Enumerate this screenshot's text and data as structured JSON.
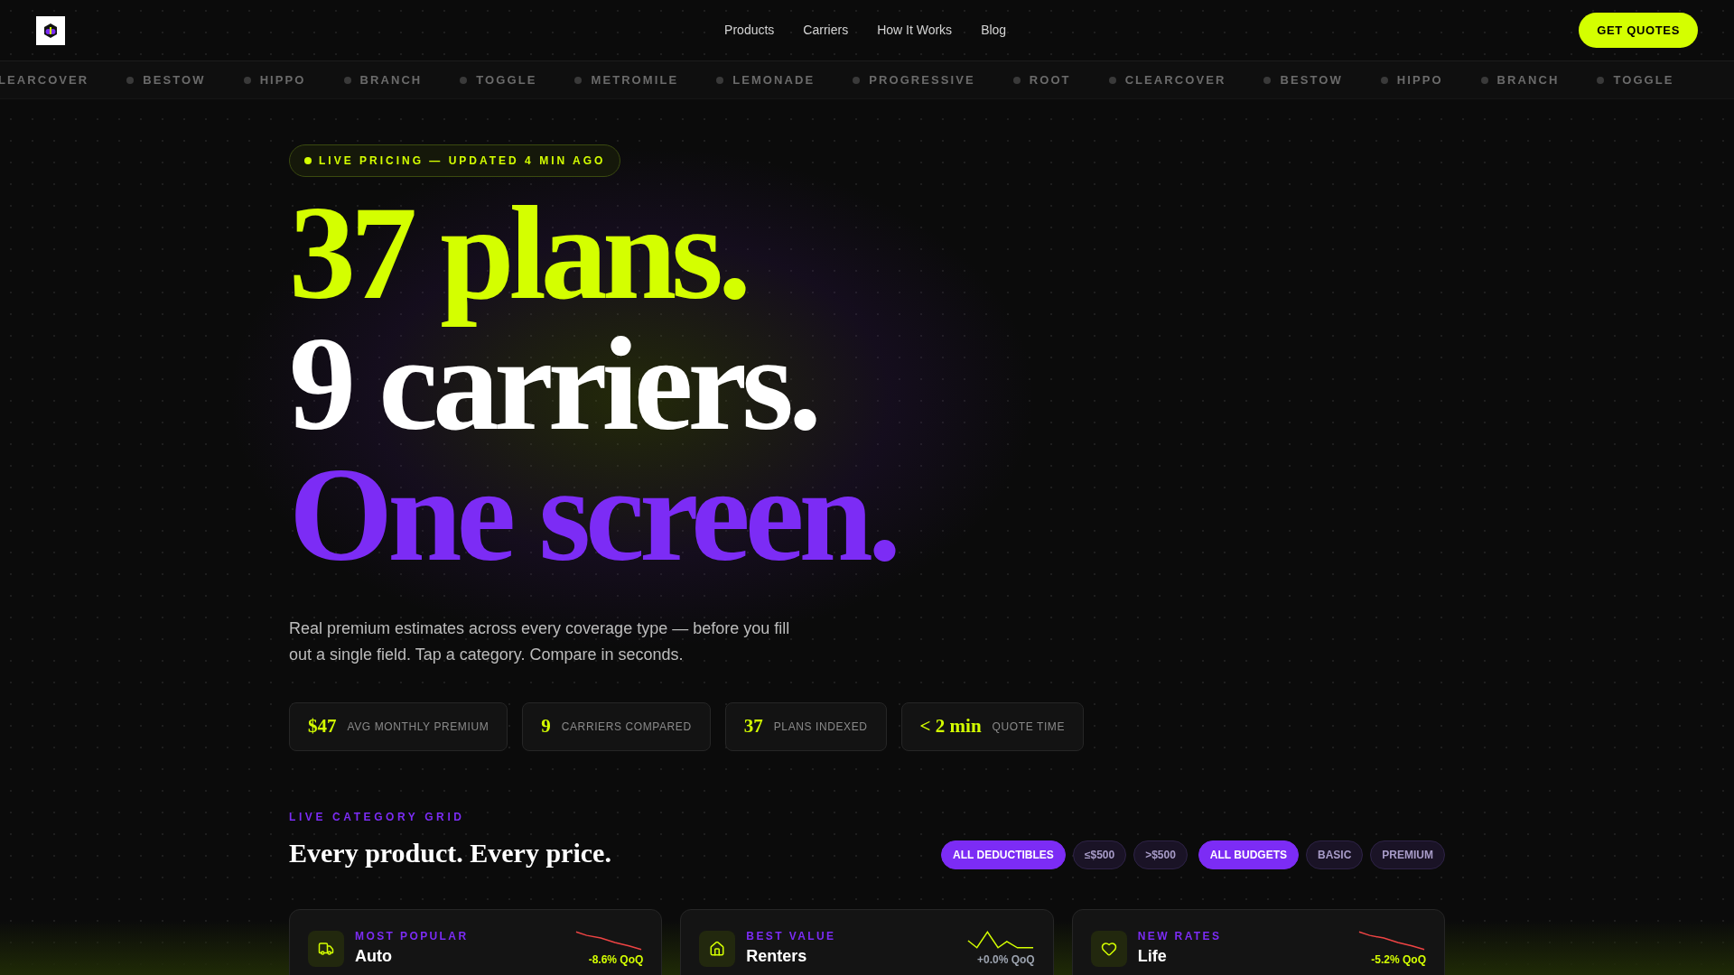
{
  "nav": {
    "links": [
      "Products",
      "Carriers",
      "How It Works",
      "Blog"
    ],
    "cta": "GET QUOTES"
  },
  "ticker": [
    {
      "name": "LEARCOVER",
      "cut": true
    },
    {
      "name": "BESTOW",
      "cut": false
    },
    {
      "name": "HIPPO",
      "cut": false
    },
    {
      "name": "BRANCH",
      "cut": false
    },
    {
      "name": "TOGGLE",
      "cut": false
    },
    {
      "name": "METROMILE",
      "cut": false
    },
    {
      "name": "LEMONADE",
      "cut": false
    },
    {
      "name": "PROGRESSIVE",
      "cut": false
    },
    {
      "name": "ROOT",
      "cut": false
    },
    {
      "name": "CLEARCOVER",
      "cut": false
    },
    {
      "name": "BESTOW",
      "cut": false
    },
    {
      "name": "HIPPO",
      "cut": false
    },
    {
      "name": "BRANCH",
      "cut": false
    },
    {
      "name": "TOGGLE",
      "cut": false
    }
  ],
  "badge": "LIVE PRICING — UPDATED 4 MIN AGO",
  "headline": [
    "37 plans.",
    "9 carriers.",
    "One screen."
  ],
  "description": "Real premium estimates across every coverage type — before you fill out a single field. Tap a category. Compare in seconds.",
  "stats": [
    {
      "value": "$47",
      "label": "AVG MONTHLY PREMIUM"
    },
    {
      "value": "9",
      "label": "CARRIERS COMPARED"
    },
    {
      "value": "37",
      "label": "PLANS INDEXED"
    },
    {
      "value": "< 2 min",
      "label": "QUOTE TIME"
    }
  ],
  "section": {
    "eyebrow": "LIVE CATEGORY GRID",
    "title": "Every product. Every price."
  },
  "filters": [
    [
      {
        "label": "ALL DEDUCTIBLES",
        "selected": true
      },
      {
        "label": "≤$500",
        "selected": false
      },
      {
        "label": ">$500",
        "selected": false
      }
    ],
    [
      {
        "label": "ALL BUDGETS",
        "selected": true
      },
      {
        "label": "BASIC",
        "selected": false
      },
      {
        "label": "PREMIUM",
        "selected": false
      }
    ]
  ],
  "cards": [
    {
      "tag": "MOST POPULAR",
      "title": "Auto",
      "change": "-8.6% QoQ",
      "kind": "down"
    },
    {
      "tag": "BEST VALUE",
      "title": "Renters",
      "change": "+0.0% QoQ",
      "kind": "flat"
    },
    {
      "tag": "NEW RATES",
      "title": "Life",
      "change": "-5.2% QoQ",
      "kind": "down"
    }
  ]
}
